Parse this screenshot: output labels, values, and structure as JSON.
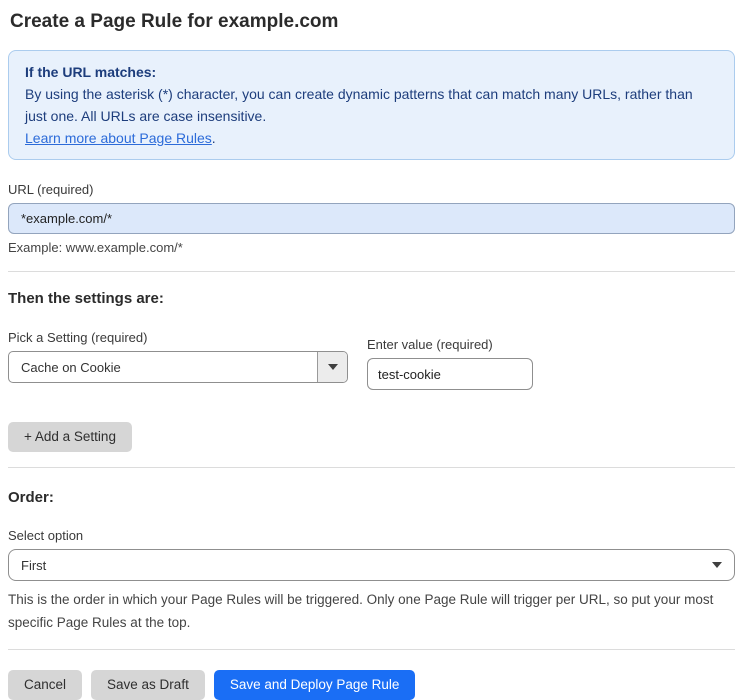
{
  "page": {
    "title": "Create a Page Rule for example.com"
  },
  "info_box": {
    "heading": "If the URL matches:",
    "body": "By using the asterisk (*) character, you can create dynamic patterns that can match many URLs, rather than just one. All URLs are case insensitive.",
    "link_label": "Learn more about Page Rules",
    "link_suffix": "."
  },
  "url_field": {
    "label": "URL (required)",
    "value": "*example.com/*",
    "helper": "Example: www.example.com/*"
  },
  "settings": {
    "heading": "Then the settings are:",
    "setting_label": "Pick a Setting (required)",
    "setting_value": "Cache on Cookie",
    "value_label": "Enter value (required)",
    "value_value": "test-cookie",
    "add_button_label": "+ Add a Setting"
  },
  "order": {
    "heading": "Order:",
    "select_label": "Select option",
    "select_value": "First",
    "help": "This is the order in which your Page Rules will be triggered. Only one Page Rule will trigger per URL, so put your most specific Page Rules at the top."
  },
  "actions": {
    "cancel_label": "Cancel",
    "save_draft_label": "Save as Draft",
    "save_deploy_label": "Save and Deploy Page Rule"
  },
  "colors": {
    "accent_blue": "#1a6ef5",
    "info_bg": "#e8f1fc",
    "info_border": "#abccee",
    "info_text": "#1d3d7c",
    "link_blue": "#2c6bd9",
    "url_input_bg": "#dce8fa",
    "button_gray": "#d6d6d6"
  }
}
